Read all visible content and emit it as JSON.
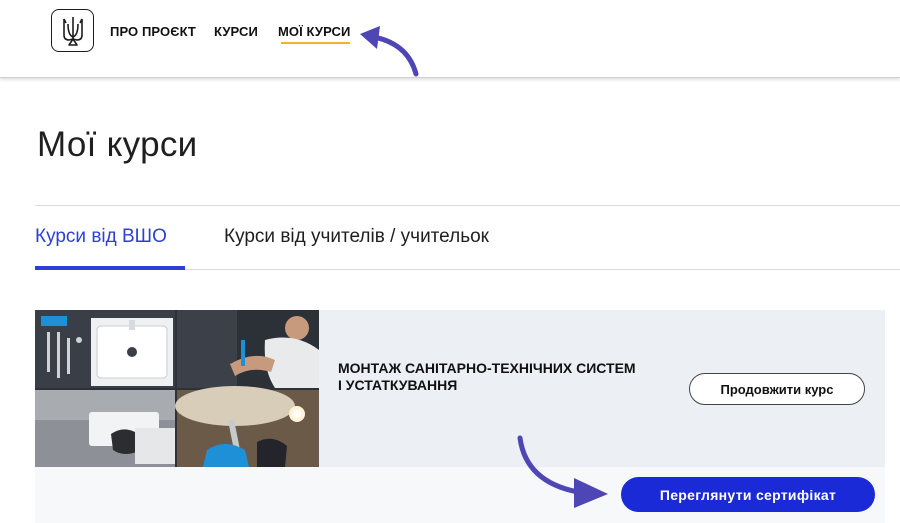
{
  "header": {
    "nav": {
      "about": "ПРО ПРОЄКТ",
      "courses": "КУРСИ",
      "my_courses": "МОЇ КУРСИ"
    },
    "active_nav": "my_courses",
    "underline_color": "#f0b429"
  },
  "main": {
    "title": "Мої курси",
    "tabs": [
      {
        "label": "Курси від ВШО",
        "active": true
      },
      {
        "label": "Курси від учителів / учительок",
        "active": false
      }
    ],
    "course": {
      "title": "МОНТАЖ САНІТАРНО-ТЕХНІЧНИХ СИСТЕМ І УСТАТКУВАННЯ",
      "continue_label": "Продовжити курс",
      "certificate_label": "Переглянути сертифікат"
    }
  },
  "colors": {
    "accent_blue": "#2f3fd6",
    "button_blue": "#1a2ad6",
    "card_bg": "#eceff4",
    "annotation_arrow": "#4f46b5"
  },
  "icons": [
    "trident-logo-icon",
    "annotation-arrow-icon"
  ]
}
